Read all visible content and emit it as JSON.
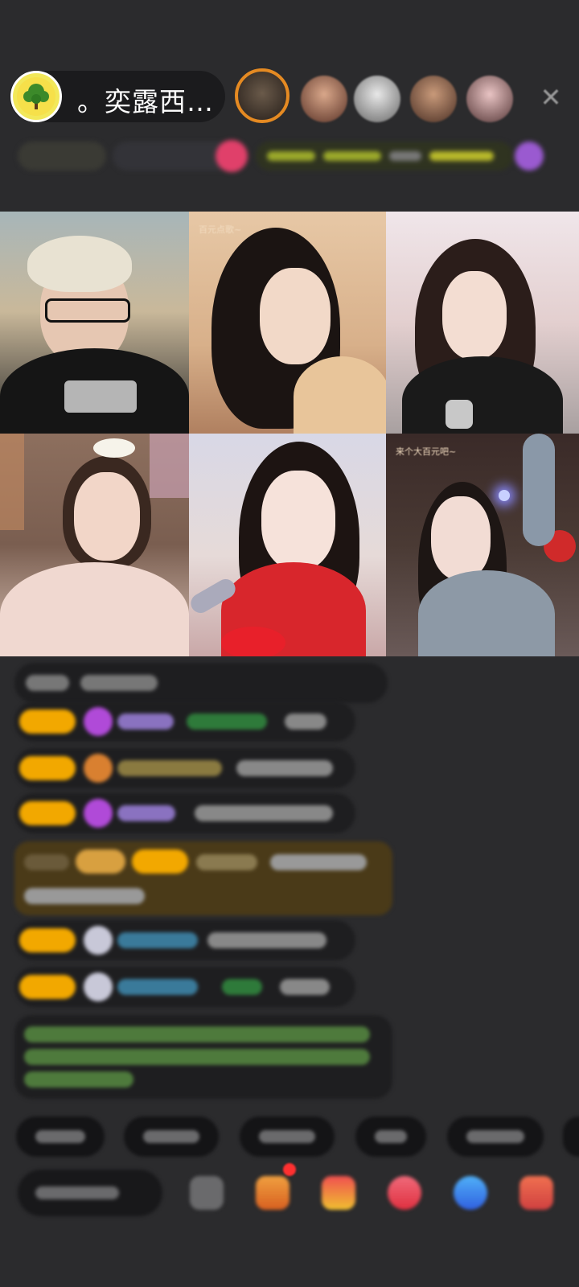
{
  "header": {
    "host_name": "。奕露西…",
    "avatar_icon": "tree-icon",
    "close_icon": "close-icon"
  },
  "colors": {
    "background": "#2b2b2d",
    "badge": "#f2a800",
    "gift_card": "#4a3a18",
    "avatar_ring": "#f2e85a"
  },
  "video_tiles": [
    {
      "position": 1
    },
    {
      "position": 2,
      "tag": "百元点歌~"
    },
    {
      "position": 3
    },
    {
      "position": 4
    },
    {
      "position": 5
    },
    {
      "position": 6,
      "tag": "来个大百元吧~"
    }
  ],
  "toolbar_icons": [
    "more-icon",
    "gift-box-icon",
    "treasure-icon",
    "red-packet-icon",
    "game-icon",
    "shop-icon"
  ]
}
